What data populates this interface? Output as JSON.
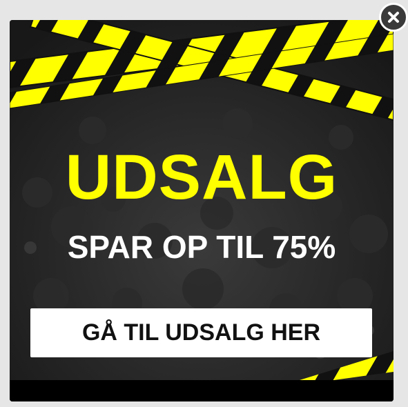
{
  "popup": {
    "headline": "UDSALG",
    "subline": "SPAR OP TIL 75%",
    "cta_label": "GÅ TIL UDSALG HER"
  },
  "close_button": {
    "icon": "close-icon"
  },
  "colors": {
    "accent": "#ffff00",
    "background": "#1a1a1a",
    "button_bg": "#ffffff",
    "button_text": "#111111"
  }
}
